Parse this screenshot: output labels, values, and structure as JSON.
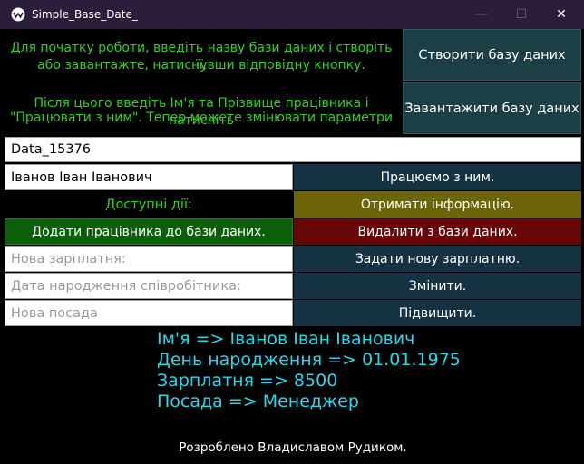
{
  "window": {
    "title": "Simple_Base_Date_",
    "minimize": "—",
    "maximize": "☐",
    "close": "✕"
  },
  "intro": {
    "line1": "Для початку роботи, введіть назву бази даних і створіть її,",
    "line2": "або завантажте, натиснувши відповідну кнопку.",
    "line3": "Після цього введіть Ім'я та Прізвище працівника і натисніть",
    "line4": "\"Працювати з ним\". Тепер можете змінювати параметри"
  },
  "buttons": {
    "create_db": "Створити базу даних",
    "load_db": "Завантажити базу даних",
    "work_with": "Працюємо з ним.",
    "get_info": "Отримати інформацію.",
    "add_employee": "Додати працівника до бази даних.",
    "delete": "Видалити з бази даних.",
    "set_salary": "Задати нову зарплатню.",
    "change": "Змінити.",
    "promote": "Підвищити."
  },
  "fields": {
    "db_name": "Data_15376",
    "employee_name": "Іванов Іван Іванович",
    "salary_placeholder": "Нова зарплатня:",
    "birthdate_placeholder": "Дата народження співробітника:",
    "position_placeholder": "Нова посада"
  },
  "labels": {
    "available_actions": "Доступні дії:"
  },
  "result": {
    "name": "Ім'я => Іванов Іван Іванович",
    "birthdate": "День народження => 01.01.1975",
    "salary": "Зарплатня => 8500",
    "position": "Посада => Менеджер"
  },
  "footer": "Розроблено Владиславом Рудиком.",
  "colors": {
    "accent_green": "#27d41b",
    "result_cyan": "#26d9ea",
    "button_teal": "#143241",
    "button_olive": "#6b6508",
    "button_red": "#650607",
    "button_green": "#0c5e0a",
    "titlebar": "#2a1e3a"
  }
}
